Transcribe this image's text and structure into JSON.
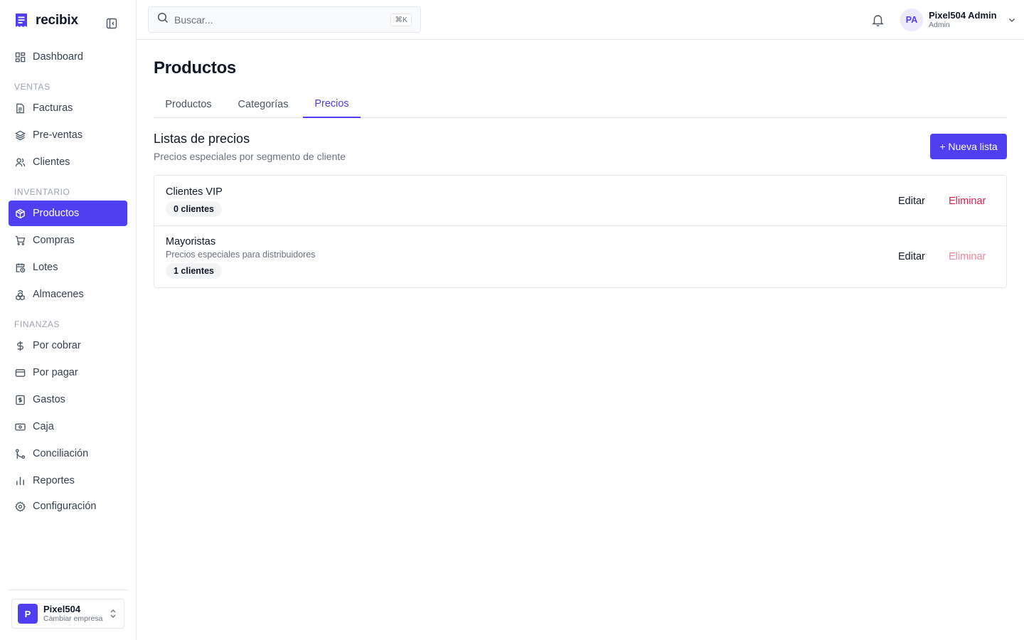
{
  "app": {
    "name": "recibix",
    "brand_color": "#4f3ff0"
  },
  "sidebar": {
    "top_item": {
      "label": "Dashboard",
      "icon": "dashboard-icon"
    },
    "sections": [
      {
        "label": "VENTAS",
        "items": [
          {
            "label": "Facturas",
            "icon": "file-text-icon"
          },
          {
            "label": "Pre-ventas",
            "icon": "layers-icon"
          },
          {
            "label": "Clientes",
            "icon": "users-icon"
          }
        ]
      },
      {
        "label": "INVENTARIO",
        "items": [
          {
            "label": "Productos",
            "icon": "package-icon",
            "active": true
          },
          {
            "label": "Compras",
            "icon": "cart-icon"
          },
          {
            "label": "Lotes",
            "icon": "calendar-clock-icon"
          },
          {
            "label": "Almacenes",
            "icon": "boxes-icon"
          }
        ]
      },
      {
        "label": "FINANZAS",
        "items": [
          {
            "label": "Por cobrar",
            "icon": "dollar-icon"
          },
          {
            "label": "Por pagar",
            "icon": "credit-card-icon"
          },
          {
            "label": "Gastos",
            "icon": "receipt-icon"
          },
          {
            "label": "Caja",
            "icon": "banknote-icon"
          },
          {
            "label": "Conciliación",
            "icon": "git-merge-icon"
          },
          {
            "label": "Reportes",
            "icon": "bar-chart-icon"
          },
          {
            "label": "Configuración",
            "icon": "gear-icon"
          }
        ]
      }
    ],
    "company": {
      "initial": "P",
      "name": "Pixel504",
      "subtitle": "Cambiar empresa"
    }
  },
  "topbar": {
    "search_placeholder": "Buscar...",
    "search_shortcut": "⌘K",
    "user": {
      "initials": "PA",
      "name": "Pixel504 Admin",
      "role": "Admin"
    }
  },
  "page": {
    "title": "Productos",
    "tabs": [
      {
        "label": "Productos",
        "active": false
      },
      {
        "label": "Categorías",
        "active": false
      },
      {
        "label": "Precios",
        "active": true
      }
    ],
    "section_title": "Listas de precios",
    "section_subtitle": "Precios especiales por segmento de cliente",
    "new_button": "+ Nueva lista",
    "price_lists": [
      {
        "name": "Clientes VIP",
        "description": "",
        "badge": "0 clientes",
        "edit": "Editar",
        "delete": "Eliminar",
        "delete_enabled": true
      },
      {
        "name": "Mayoristas",
        "description": "Precios especiales para distribuidores",
        "badge": "1 clientes",
        "edit": "Editar",
        "delete": "Eliminar",
        "delete_enabled": false
      }
    ]
  }
}
